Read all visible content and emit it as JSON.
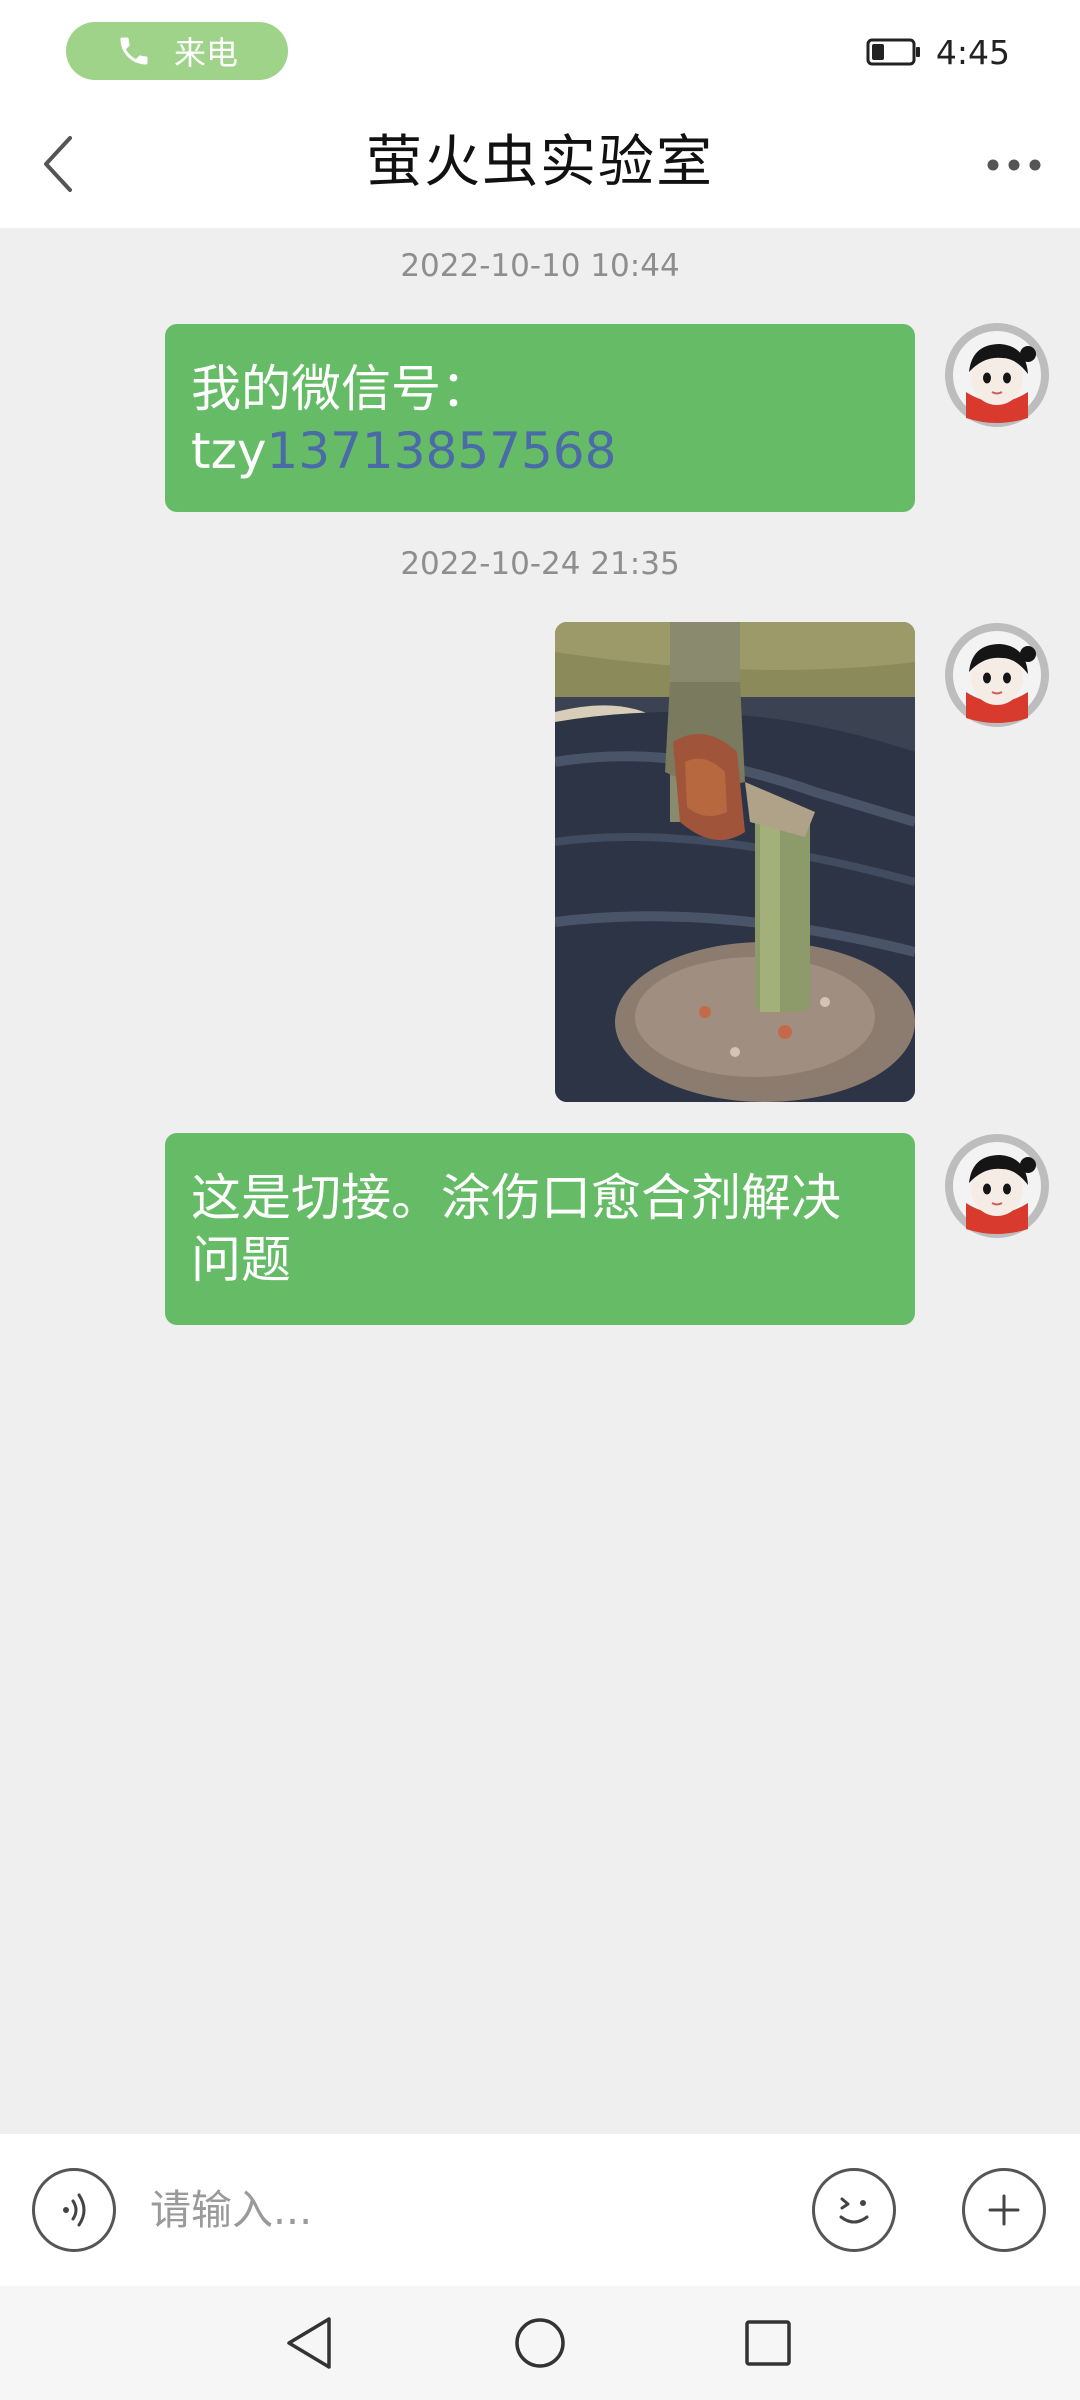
{
  "status_bar": {
    "call_label": "来电",
    "time": "4:45",
    "call_pill_color": "#9fd38a"
  },
  "header": {
    "title": "萤火虫实验室",
    "back_icon": "chevron-left-icon",
    "more_icon": "more-dots-icon"
  },
  "messages": [
    {
      "timestamp": "2022-10-10 10:44",
      "sender": "self",
      "type": "text",
      "line1": "我的微信号：",
      "prefix": "tzy",
      "link": "13713857568"
    },
    {
      "timestamp": "2022-10-24 21:35",
      "sender": "self",
      "type": "image",
      "image_subject": "grafted tree trunk"
    },
    {
      "sender": "self",
      "type": "text",
      "text": "这是切接。涂伤口愈合剂解决问题"
    }
  ],
  "input_bar": {
    "placeholder": "请输入...",
    "voice_icon": "voice-icon",
    "emoji_icon": "emoji-icon",
    "plus_icon": "plus-icon"
  },
  "nav_bar": {
    "back_icon": "nav-back-icon",
    "home_icon": "nav-home-icon",
    "recents_icon": "nav-recents-icon"
  },
  "colors": {
    "bubble": "#66bb66",
    "link": "#4a6aa8",
    "background": "#efefef"
  }
}
